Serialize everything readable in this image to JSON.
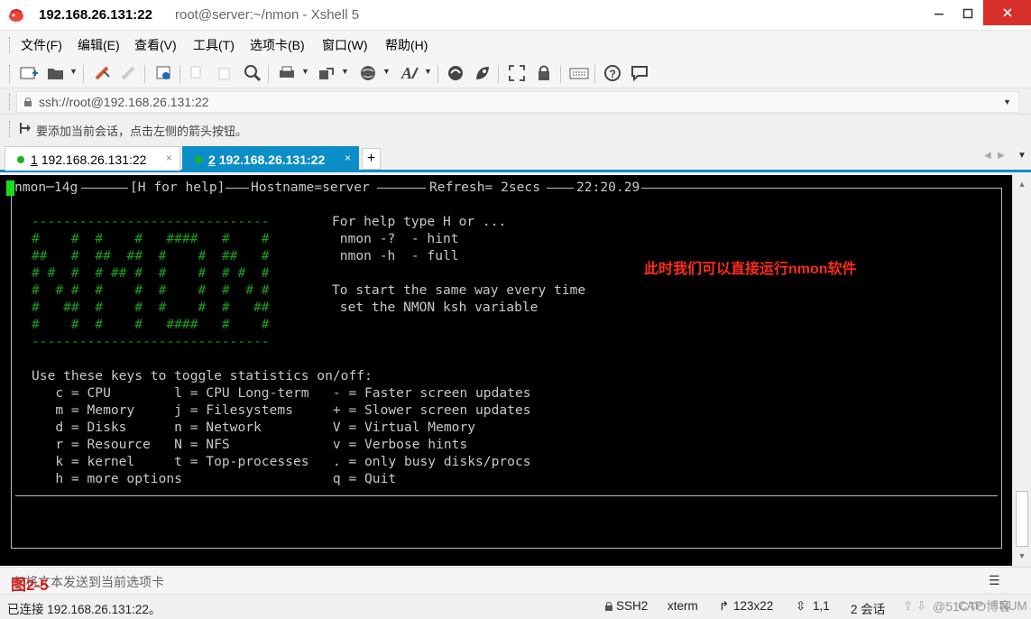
{
  "window": {
    "title_host": "192.168.26.131:22",
    "title_session": "root@server:~/nmon - Xshell 5"
  },
  "menu": [
    "文件(F)",
    "编辑(E)",
    "查看(V)",
    "工具(T)",
    "选项卡(B)",
    "窗口(W)",
    "帮助(H)"
  ],
  "toolbar_icons": [
    "new-session-icon",
    "open-folder-icon",
    "connect-icon",
    "disconnect-icon",
    "properties-icon",
    "copy-icon",
    "paste-icon",
    "find-icon",
    "print-icon",
    "transfer-icon",
    "globe-icon",
    "font-icon",
    "xftp-icon",
    "xmanager-icon",
    "fullscreen-icon",
    "lock-icon",
    "keyboard-icon",
    "help-icon",
    "chat-icon"
  ],
  "address": {
    "value": "ssh://root@192.168.26.131:22"
  },
  "hint": {
    "text": "要添加当前会话，点击左侧的箭头按钮。"
  },
  "tabs": [
    {
      "num": "1",
      "label": "192.168.26.131:22",
      "active": false
    },
    {
      "num": "2",
      "label": "192.168.26.131:22",
      "active": true
    }
  ],
  "terminal": {
    "header": {
      "seg1": "nmon─14g",
      "seg2": "[H for help]",
      "seg3": "Hostname=server",
      "seg4": "Refresh= 2secs",
      "seg5": "22:20.29"
    },
    "logo_lines": [
      "------------------------------",
      "#    #  #    #   ####   #    #",
      "##   #  ##  ##  #    #  ##   #",
      "# #  #  # ## #  #    #  # #  #",
      "#  # #  #    #  #    #  #  # #",
      "#   ##  #    #  #    #  #   ##",
      "#    #  #    #   ####   #    #",
      "------------------------------"
    ],
    "help_lines": [
      "For help type H or ...",
      " nmon -?  - hint",
      " nmon -h  - full",
      "",
      "To start the same way every time",
      " set the NMON ksh variable"
    ],
    "keys_title": "Use these keys to toggle statistics on/off:",
    "key_lines": [
      "   c = CPU        l = CPU Long-term   - = Faster screen updates",
      "   m = Memory     j = Filesystems     + = Slower screen updates",
      "   d = Disks      n = Network         V = Virtual Memory",
      "   r = Resource   N = NFS             v = Verbose hints",
      "   k = kernel     t = Top-processes   . = only busy disks/procs",
      "   h = more options                   q = Quit"
    ],
    "annotation": "此时我们可以直接运行nmon软件"
  },
  "compose": {
    "placeholder": "仅将文本发送到当前选项卡",
    "figure_label": "图2-5"
  },
  "status": {
    "connected": "已连接 192.168.26.131:22。",
    "protocol": "SSH2",
    "term": "xterm",
    "size": "123x22",
    "pos": "1,1",
    "sessions": "2 会话",
    "caps": "CAP",
    "num": "NUM",
    "watermark": "@51CTO博客"
  }
}
